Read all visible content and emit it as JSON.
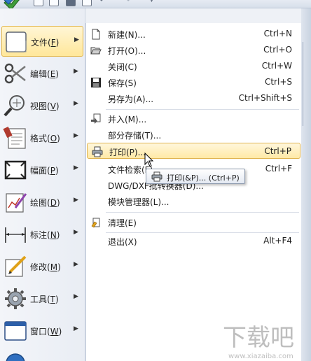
{
  "categories": [
    {
      "label": "文件",
      "accel": "F",
      "icon": "file-icon",
      "active": true
    },
    {
      "label": "编辑",
      "accel": "E",
      "icon": "scissors-icon"
    },
    {
      "label": "视图",
      "accel": "V",
      "icon": "magnifier-icon"
    },
    {
      "label": "格式",
      "accel": "O",
      "icon": "format-icon"
    },
    {
      "label": "幅面",
      "accel": "P",
      "icon": "frame-icon"
    },
    {
      "label": "绘图",
      "accel": "D",
      "icon": "drawing-icon"
    },
    {
      "label": "标注",
      "accel": "N",
      "icon": "dimension-icon"
    },
    {
      "label": "修改",
      "accel": "M",
      "icon": "edit-pencil-icon"
    },
    {
      "label": "工具",
      "accel": "T",
      "icon": "gear-icon"
    },
    {
      "label": "窗口",
      "accel": "W",
      "icon": "window-icon"
    }
  ],
  "file_menu": [
    {
      "label": "新建(N)...",
      "shortcut": "Ctrl+N",
      "icon": "new-document-icon"
    },
    {
      "label": "打开(O)...",
      "shortcut": "Ctrl+O",
      "icon": "open-folder-icon"
    },
    {
      "label": "关闭(C)",
      "shortcut": "Ctrl+W",
      "icon": ""
    },
    {
      "label": "保存(S)",
      "shortcut": "Ctrl+S",
      "icon": "save-icon"
    },
    {
      "label": "另存为(A)...",
      "shortcut": "Ctrl+Shift+S",
      "icon": ""
    },
    {
      "label": "并入(M)...",
      "shortcut": "",
      "icon": "merge-icon"
    },
    {
      "label": "部分存储(T)...",
      "shortcut": "",
      "icon": ""
    },
    {
      "label": "打印(P)...",
      "shortcut": "Ctrl+P",
      "icon": "printer-icon",
      "hover": true
    },
    {
      "label": "文件检索(F)...",
      "shortcut": "Ctrl+F",
      "icon": ""
    },
    {
      "label": "DWG/DXF批转换器(D)...",
      "shortcut": "",
      "icon": ""
    },
    {
      "label": "模块管理器(L)...",
      "shortcut": "",
      "icon": ""
    },
    {
      "label": "清理(E)",
      "shortcut": "",
      "icon": "cleanup-icon"
    },
    {
      "label": "退出(X)",
      "shortcut": "Alt+F4",
      "icon": ""
    }
  ],
  "tooltip": {
    "label": "打印(&P)... (Ctrl+P)",
    "icon": "printer-icon"
  },
  "watermark": {
    "text": "下载吧",
    "url": "www.xiazaiba.com"
  },
  "colors": {
    "hover_bg": "#ffe9a6",
    "hover_border": "#e0b34f",
    "menu_bg": "#ffffff",
    "panel_bg": "#eef1f6"
  }
}
